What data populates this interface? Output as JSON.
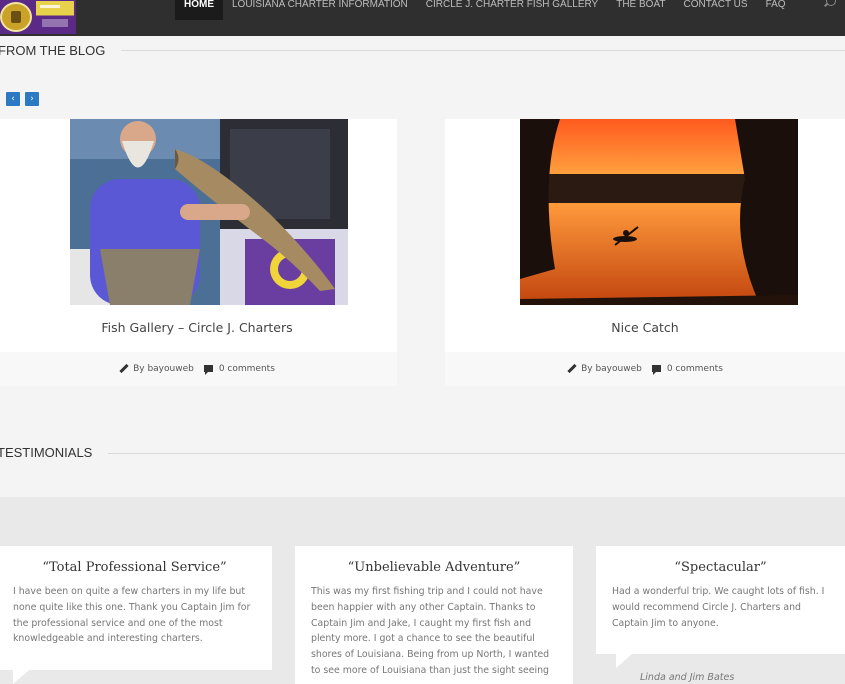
{
  "nav": {
    "items": [
      {
        "label": "HOME",
        "active": true
      },
      {
        "label": "LOUISIANA CHARTER INFORMATION",
        "active": false
      },
      {
        "label": "CIRCLE J. CHARTER FISH GALLERY",
        "active": false
      },
      {
        "label": "THE BOAT",
        "active": false
      },
      {
        "label": "CONTACT US",
        "active": false
      },
      {
        "label": "FAQ",
        "active": false
      }
    ],
    "search_icon": "search-icon"
  },
  "blog": {
    "heading": "FROM THE BLOG",
    "prev_label": "‹",
    "next_label": "›",
    "posts": [
      {
        "title": "Fish Gallery – Circle J. Charters",
        "author": "By bayouweb",
        "comments": "0 comments"
      },
      {
        "title": "Nice Catch",
        "author": "By bayouweb",
        "comments": "0 comments"
      }
    ]
  },
  "testimonials": {
    "heading": "TESTIMONIALS",
    "items": [
      {
        "title": "“Total Professional Service”",
        "body": "I have been on quite a few charters in my life but none quite like this one. Thank you Captain Jim for the professional service and one of the most knowledgeable and interesting charters."
      },
      {
        "title": "“Unbelievable Adventure”",
        "body": "This was my first fishing trip and I could not have been happier with any other Captain. Thanks to Captain Jim and Jake, I caught my first fish and plenty more. I got a chance to see the beautiful shores of Louisiana. Being from up North, I wanted to see more of Louisiana than just the sight seeing"
      },
      {
        "title": "“Spectacular”",
        "body": "Had a wonderful trip. We caught lots of fish. I would recommend Circle J. Charters and Captain Jim to anyone.",
        "author": "Linda and Jim Bates"
      }
    ]
  },
  "colors": {
    "nav_bg": "#2f2f2f",
    "accent_blue": "#2a79c2",
    "page_bg": "#f4f4f4"
  }
}
